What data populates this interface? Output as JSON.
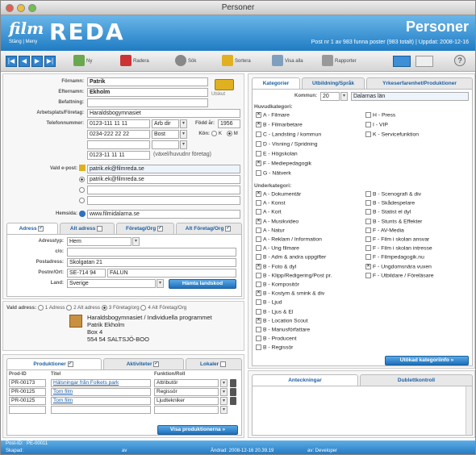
{
  "window": {
    "title": "Personer"
  },
  "header": {
    "logo_film": "film",
    "logo_sub": "Stäng | Meny",
    "logo_reda": "REDA",
    "title": "Personer",
    "status": "Post nr 1 av 983 funna poster (983 totalt) | Uppdat: 2008-12-16"
  },
  "toolbar": {
    "nav": [
      "|◀",
      "◀",
      "▶",
      "▶|"
    ],
    "buttons": [
      {
        "label": "Ny",
        "icon": "person-add-icon",
        "color": "#6aa84f"
      },
      {
        "label": "Radera",
        "icon": "person-delete-icon",
        "color": "#cc3333"
      },
      {
        "label": "Sök",
        "icon": "magnifier-icon",
        "color": "#888888"
      },
      {
        "label": "Sortera",
        "icon": "sort-icon",
        "color": "#e0b020"
      },
      {
        "label": "Visa alla",
        "icon": "show-all-icon",
        "color": "#7f9fbf"
      },
      {
        "label": "Rapporter",
        "icon": "printer-icon",
        "color": "#999999"
      }
    ]
  },
  "person": {
    "fornamn_label": "Förnamn:",
    "fornamn": "Patrik",
    "efternamn_label": "Efternamn:",
    "efternamn": "Ekholm",
    "utskut": "Utskut",
    "befattning_label": "Befattning:",
    "befattning": "",
    "arbetsplats_label": "Arbetsplats/Företag:",
    "arbetsplats": "Haraldsbogymnasiet",
    "telefon_label": "Telefonnummer:",
    "phones": [
      {
        "number": "0123-111 11 11",
        "type": "Arb dir"
      },
      {
        "number": "0234-222 22 22",
        "type": "Bost"
      },
      {
        "number": "",
        "type": ""
      },
      {
        "number": "0123-11 11 11",
        "type": "(växel/huvudnr företag)"
      }
    ],
    "fodd_label": "Född år:",
    "fodd": "1956",
    "kon_label": "Kön:",
    "kon_k": "K",
    "kon_m": "M",
    "epost_label": "Vald e-post:",
    "epost": [
      "patrik.ek@filmreda.se",
      "patrik.ek@filmreda.se",
      "",
      ""
    ],
    "hemsida_label": "Hemsida:",
    "hemsida": "www.filmidalarna.se"
  },
  "addr_tabs": [
    "Adress",
    "Alt adress",
    "Företag/Org",
    "Alt Företag/Org"
  ],
  "address": {
    "typ_label": "Adresstyp:",
    "typ": "Hem",
    "co_label": "c/o:",
    "co": "",
    "post_label": "Postadress:",
    "post": "Skolgatan 21",
    "postnr_label": "Postnr/Ort:",
    "postnr": "SE-714 94",
    "ort": "FALUN",
    "land_label": "Land:",
    "land": "Sverige",
    "fetch_btn": "Hämta landskod"
  },
  "vald_adress": {
    "label": "Vald adress:",
    "options": [
      "1 Adress",
      "2 Alt adress",
      "3 Företag/org",
      "4 Alt Företag/Org"
    ],
    "lines": [
      "Haraldsbogymnasiet / Individuella programmet",
      "Patrik Ekholm",
      "Box 4",
      "554 54  SALTSJÖ-BOO"
    ]
  },
  "prod_tabs": [
    "Produktioner",
    "Aktiviteter",
    "Lokaler"
  ],
  "productions": {
    "headers": [
      "Prod-ID",
      "Titel",
      "Funktion/Roll"
    ],
    "rows": [
      [
        "PR-00173",
        "Hälsningar från Folkets park",
        "Attributör"
      ],
      [
        "PR-00125",
        "Tom film",
        "Regissör"
      ],
      [
        "PR-00125",
        "Tom film",
        "Ljudtekniker"
      ]
    ],
    "button": "Visa produktionerna »"
  },
  "cat_tabs": [
    "Kategorier",
    "Utbildning/Språk",
    "Yrkeserfarenhet/Produktioner"
  ],
  "kommun": {
    "label": "Kommun:",
    "num": "20",
    "name": "Dalarnas län"
  },
  "huvudkategori": {
    "label": "Huvudkategori:",
    "left": [
      [
        "A - Filmare",
        true
      ],
      [
        "B - Filmarbetare",
        true
      ],
      [
        "C - Landsting / kommun",
        false
      ],
      [
        "D - Visning / Spridning",
        false
      ],
      [
        "E - Högskolan",
        false
      ],
      [
        "F - Mediepedagogik",
        true
      ],
      [
        "G - Nätverk",
        false
      ]
    ],
    "right": [
      [
        "H - Press",
        false
      ],
      [
        "I - VIP",
        false
      ],
      [
        "K - Servicefunktion",
        false
      ]
    ]
  },
  "underkategori": {
    "label": "Underkategori:",
    "left": [
      [
        "A - Dokumentär",
        true
      ],
      [
        "A - Konst",
        false
      ],
      [
        "A - Kort",
        false
      ],
      [
        "A - Musikvideo",
        true
      ],
      [
        "A - Natur",
        false
      ],
      [
        "A - Reklam / Information",
        false
      ],
      [
        "A - Ung filmare",
        false
      ],
      [
        "B - Adm & andra uppgifter",
        false
      ],
      [
        "B - Foto & dyl",
        true
      ],
      [
        "B - Klipp/Redigering/Post pr.",
        false
      ],
      [
        "B - Kompositör",
        false
      ],
      [
        "B - Kostym & smink & div",
        true
      ],
      [
        "B - Ljud",
        false
      ],
      [
        "B - Ljus & El",
        false
      ],
      [
        "B - Location Scout",
        true
      ],
      [
        "B - Manusförfattare",
        false
      ],
      [
        "B - Producent",
        false
      ],
      [
        "B - Regissör",
        false
      ]
    ],
    "right": [
      [
        "B - Scenografi & div",
        false
      ],
      [
        "B - Skådespelare",
        false
      ],
      [
        "B - Statist el dyl",
        false
      ],
      [
        "B - Stunts & Effekter",
        false
      ],
      [
        "F - AV-Media",
        false
      ],
      [
        "F - Film i skolan ansvar",
        false
      ],
      [
        "F - Film i skolan intresse",
        false
      ],
      [
        "F - Filmpedagogik.nu",
        false
      ],
      [
        "F - Ungdomsnära vuxen",
        true
      ],
      [
        "F - Utbildare / Föreläsare",
        false
      ]
    ]
  },
  "cat_button": "Utökad kategoriinfo »",
  "notes_tabs": [
    "Anteckningar",
    "Dublettkontroll"
  ],
  "footer": {
    "post_id_label": "Post-ID:",
    "post_id": "PE-00011",
    "skapad_label": "Skapad:",
    "skapad_av": "av",
    "andrad": "Ändrad: 2008-12-16 20.39.19",
    "andrad_av": "av: Developer"
  }
}
